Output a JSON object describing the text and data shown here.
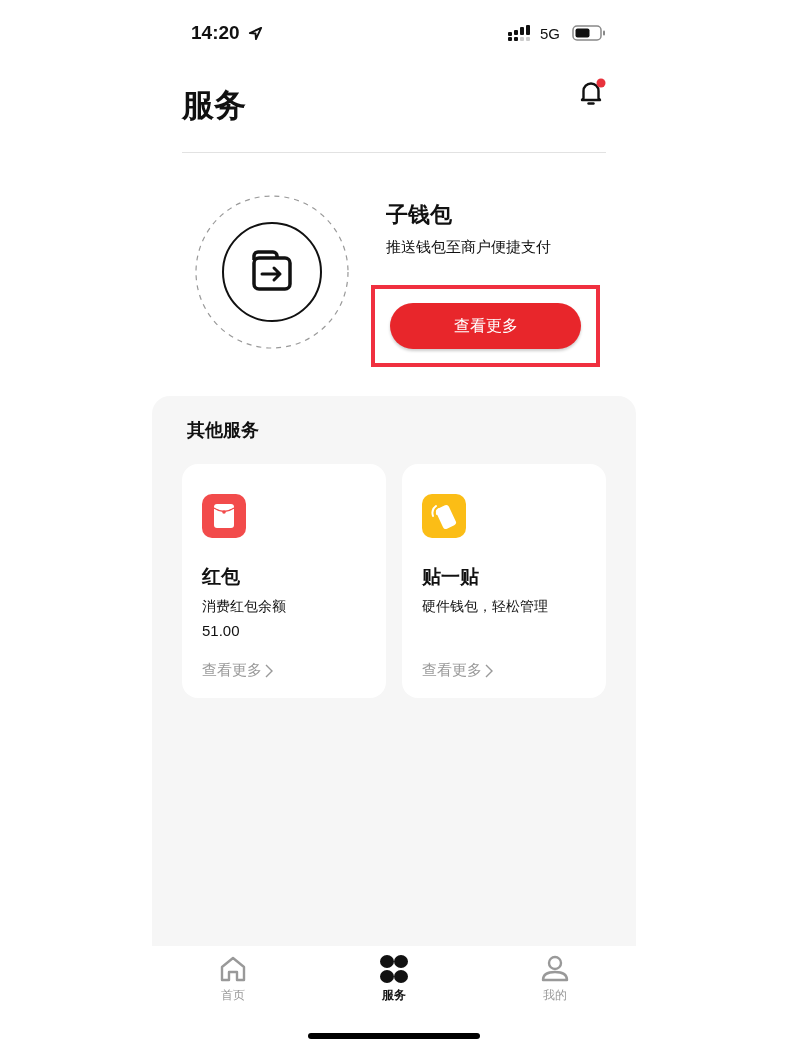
{
  "status_bar": {
    "time": "14:20",
    "network": "5G"
  },
  "header": {
    "title": "服务",
    "notification_unread": true
  },
  "feature": {
    "title": "子钱包",
    "subtitle": "推送钱包至商户便捷支付",
    "button": "查看更多",
    "highlighted": true
  },
  "other_services": {
    "title": "其他服务",
    "cards": [
      {
        "kind": "red-packet",
        "title": "红包",
        "description": "消费红包余额",
        "amount": "51.00",
        "link": "查看更多"
      },
      {
        "kind": "tap",
        "title": "贴一贴",
        "description": "硬件钱包，轻松管理",
        "link": "查看更多"
      }
    ]
  },
  "tab_bar": [
    {
      "kind": "home",
      "label": "首页",
      "selected": false
    },
    {
      "kind": "services",
      "label": "服务",
      "selected": true
    },
    {
      "kind": "me",
      "label": "我的",
      "selected": false
    }
  ]
}
